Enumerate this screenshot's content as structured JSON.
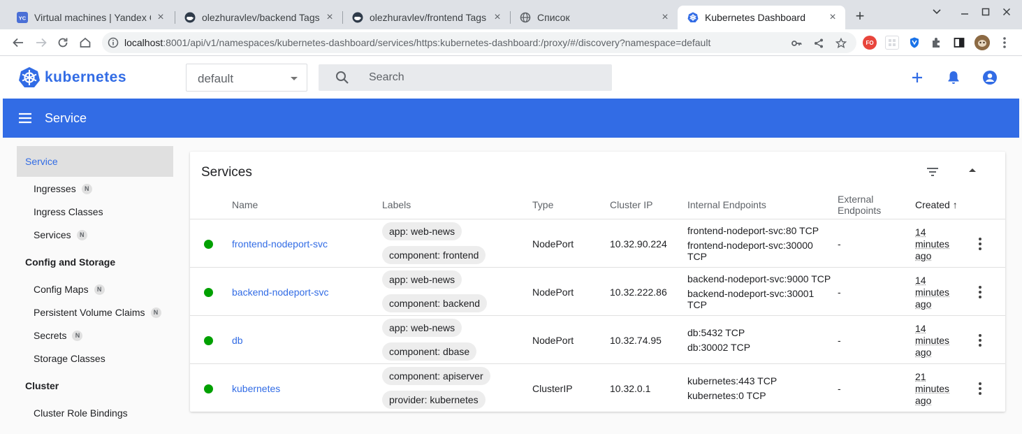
{
  "browser": {
    "tabs": [
      {
        "title": "Virtual machines | Yandex Cloud",
        "icon": "yandex-cloud-icon"
      },
      {
        "title": "olezhuravlev/backend Tags | Docker Hub",
        "icon": "docker-hub-icon"
      },
      {
        "title": "olezhuravlev/frontend Tags | Docker Hub",
        "icon": "docker-hub-icon"
      },
      {
        "title": "Список",
        "icon": "globe-icon"
      },
      {
        "title": "Kubernetes Dashboard",
        "icon": "kubernetes-icon"
      }
    ],
    "favicon_text_yc": "YC",
    "url_host": "localhost",
    "url_rest": ":8001/api/v1/namespaces/kubernetes-dashboard/services/https:kubernetes-dashboard:/proxy/#/discovery?namespace=default",
    "ext_badge": "FO"
  },
  "header": {
    "brand": "kubernetes",
    "namespace": "default",
    "search_placeholder": "Search"
  },
  "toolbar": {
    "title": "Service"
  },
  "sidebar": {
    "selected": "Service",
    "items": [
      {
        "label": "Ingresses",
        "badge": "N"
      },
      {
        "label": "Ingress Classes",
        "badge": ""
      },
      {
        "label": "Services",
        "badge": "N"
      }
    ],
    "section_config": "Config and Storage",
    "config_items": [
      {
        "label": "Config Maps",
        "badge": "N"
      },
      {
        "label": "Persistent Volume Claims",
        "badge": "N"
      },
      {
        "label": "Secrets",
        "badge": "N"
      },
      {
        "label": "Storage Classes",
        "badge": ""
      }
    ],
    "section_cluster": "Cluster",
    "cluster_items": [
      {
        "label": "Cluster Role Bindings",
        "badge": ""
      }
    ]
  },
  "services": {
    "title": "Services",
    "columns": {
      "name": "Name",
      "labels": "Labels",
      "type": "Type",
      "cluster_ip": "Cluster IP",
      "internal": "Internal Endpoints",
      "external_1": "External",
      "external_2": "Endpoints",
      "created": "Created"
    },
    "sort_arrow": "↑",
    "rows": [
      {
        "name": "frontend-nodeport-svc",
        "labels": [
          "app: web-news",
          "component: frontend"
        ],
        "type": "NodePort",
        "cluster_ip": "10.32.90.224",
        "endpoints": [
          "frontend-nodeport-svc:80 TCP",
          "frontend-nodeport-svc:30000",
          "TCP"
        ],
        "external": "-",
        "created": [
          "14",
          "minutes",
          "ago"
        ]
      },
      {
        "name": "backend-nodeport-svc",
        "labels": [
          "app: web-news",
          "component: backend"
        ],
        "type": "NodePort",
        "cluster_ip": "10.32.222.86",
        "endpoints": [
          "backend-nodeport-svc:9000 TCP",
          "backend-nodeport-svc:30001",
          "TCP"
        ],
        "external": "-",
        "created": [
          "14",
          "minutes",
          "ago"
        ]
      },
      {
        "name": "db",
        "labels": [
          "app: web-news",
          "component: dbase"
        ],
        "type": "NodePort",
        "cluster_ip": "10.32.74.95",
        "endpoints": [
          "db:5432 TCP",
          "db:30002 TCP"
        ],
        "external": "-",
        "created": [
          "14",
          "minutes",
          "ago"
        ]
      },
      {
        "name": "kubernetes",
        "labels": [
          "component: apiserver",
          "provider: kubernetes"
        ],
        "type": "ClusterIP",
        "cluster_ip": "10.32.0.1",
        "endpoints": [
          "kubernetes:443 TCP",
          "kubernetes:0 TCP"
        ],
        "external": "-",
        "created": [
          "21",
          "minutes",
          "ago"
        ]
      }
    ]
  },
  "colors": {
    "k8s_blue": "#326ce5",
    "status_green": "#00a000"
  }
}
